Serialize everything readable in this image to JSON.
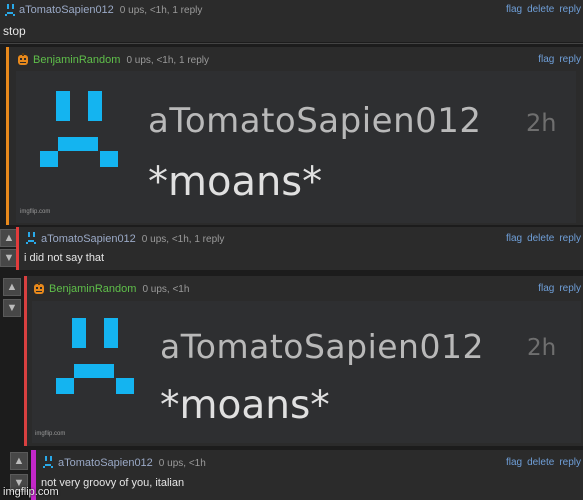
{
  "actions": {
    "flag": "flag",
    "delete": "delete",
    "reply": "reply"
  },
  "comments": [
    {
      "user": "aTomatoSapien012",
      "meta": "0 ups, <1h, 1 reply",
      "text": "stop",
      "bar_color": "#2b2b2b"
    },
    {
      "user": "BenjaminRandom",
      "meta": "0 ups, <1h, 1 reply",
      "text": "",
      "bar_color": "#e8891c"
    },
    {
      "user": "aTomatoSapien012",
      "meta": "0 ups, <1h, 1 reply",
      "text": "i did not say that",
      "bar_color": "#e23b3b"
    },
    {
      "user": "BenjaminRandom",
      "meta": "0 ups, <1h",
      "text": "",
      "bar_color": "#d84040"
    },
    {
      "user": "aTomatoSapien012",
      "meta": "0 ups, <1h",
      "text": "not very groovy of you, italian",
      "bar_color": "#c327c9"
    }
  ],
  "embed": {
    "name": "aTomatoSapien012",
    "ago": "2h",
    "text": "*moans*",
    "watermark": "imgflip.com"
  },
  "watermark": "imgflip.com",
  "icons": {
    "upvote": "arrow-up-icon",
    "downvote": "arrow-down-icon"
  },
  "colors": {
    "link": "#6f9fd8",
    "blue_avatar": "#29a9e8",
    "orange_avatar": "#e8891c"
  }
}
